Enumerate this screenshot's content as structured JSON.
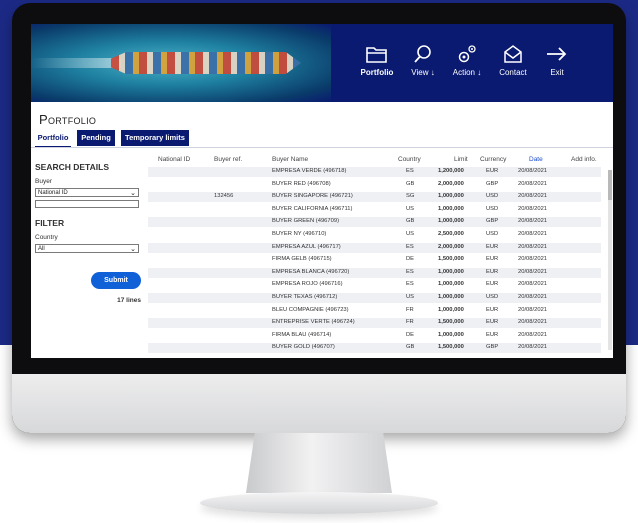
{
  "header": {
    "nav": [
      {
        "label": "Portfolio",
        "icon": "folder-icon",
        "active": true
      },
      {
        "label": "View ↓",
        "icon": "search-icon",
        "active": false
      },
      {
        "label": "Action ↓",
        "icon": "gears-icon",
        "active": false
      },
      {
        "label": "Contact",
        "icon": "envelope-icon",
        "active": false
      },
      {
        "label": "Exit",
        "icon": "arrow-right-icon",
        "active": false
      }
    ]
  },
  "page": {
    "title": "Portfolio",
    "tabs": [
      {
        "label": "Portfolio"
      },
      {
        "label": "Pending"
      },
      {
        "label": "Temporary limits"
      }
    ]
  },
  "sidebar": {
    "search_title": "SEARCH DETAILS",
    "buyer_label": "Buyer",
    "buyer_select_value": "National ID",
    "buyer_input_value": "",
    "filter_title": "FILTER",
    "country_label": "Country",
    "country_select_value": "All",
    "submit_label": "Submit",
    "lines_count": "17 lines"
  },
  "table": {
    "columns": [
      "National ID",
      "Buyer ref.",
      "Buyer Name",
      "Country",
      "Limit",
      "Currency",
      "Date",
      "Add info."
    ],
    "rows": [
      {
        "national_id": "",
        "buyer_ref": "",
        "buyer_name": "EMPRESA VERDE (496718)",
        "country": "ES",
        "limit": "1,200,000",
        "currency": "EUR",
        "date": "20/08/2021",
        "add_info": ""
      },
      {
        "national_id": "",
        "buyer_ref": "",
        "buyer_name": "BUYER RED (496708)",
        "country": "GB",
        "limit": "2,000,000",
        "currency": "GBP",
        "date": "20/08/2021",
        "add_info": ""
      },
      {
        "national_id": "",
        "buyer_ref": "132456",
        "buyer_name": "BUYER SINGAPORE (496721)",
        "country": "SG",
        "limit": "1,000,000",
        "currency": "USD",
        "date": "20/08/2021",
        "add_info": ""
      },
      {
        "national_id": "",
        "buyer_ref": "",
        "buyer_name": "BUYER CALIFORNIA (496711)",
        "country": "US",
        "limit": "1,000,000",
        "currency": "USD",
        "date": "20/08/2021",
        "add_info": ""
      },
      {
        "national_id": "",
        "buyer_ref": "",
        "buyer_name": "BUYER GREEN (496709)",
        "country": "GB",
        "limit": "1,000,000",
        "currency": "GBP",
        "date": "20/08/2021",
        "add_info": ""
      },
      {
        "national_id": "",
        "buyer_ref": "",
        "buyer_name": "BUYER NY (496710)",
        "country": "US",
        "limit": "2,500,000",
        "currency": "USD",
        "date": "20/08/2021",
        "add_info": ""
      },
      {
        "national_id": "",
        "buyer_ref": "",
        "buyer_name": "EMPRESA AZUL (496717)",
        "country": "ES",
        "limit": "2,000,000",
        "currency": "EUR",
        "date": "20/08/2021",
        "add_info": ""
      },
      {
        "national_id": "",
        "buyer_ref": "",
        "buyer_name": "FIRMA GELB (496715)",
        "country": "DE",
        "limit": "1,500,000",
        "currency": "EUR",
        "date": "20/08/2021",
        "add_info": ""
      },
      {
        "national_id": "",
        "buyer_ref": "",
        "buyer_name": "EMPRESA BLANCA (496720)",
        "country": "ES",
        "limit": "1,000,000",
        "currency": "EUR",
        "date": "20/08/2021",
        "add_info": ""
      },
      {
        "national_id": "",
        "buyer_ref": "",
        "buyer_name": "EMPRESA ROJO (496716)",
        "country": "ES",
        "limit": "1,000,000",
        "currency": "EUR",
        "date": "20/08/2021",
        "add_info": ""
      },
      {
        "national_id": "",
        "buyer_ref": "",
        "buyer_name": "BUYER TEXAS (496712)",
        "country": "US",
        "limit": "1,000,000",
        "currency": "USD",
        "date": "20/08/2021",
        "add_info": ""
      },
      {
        "national_id": "",
        "buyer_ref": "",
        "buyer_name": "BLEU COMPAGNIE (496723)",
        "country": "FR",
        "limit": "1,000,000",
        "currency": "EUR",
        "date": "20/08/2021",
        "add_info": ""
      },
      {
        "national_id": "",
        "buyer_ref": "",
        "buyer_name": "ENTREPRISE VERTE (496724)",
        "country": "FR",
        "limit": "1,500,000",
        "currency": "EUR",
        "date": "20/08/2021",
        "add_info": ""
      },
      {
        "national_id": "",
        "buyer_ref": "",
        "buyer_name": "FIRMA BLAU (496714)",
        "country": "DE",
        "limit": "1,000,000",
        "currency": "EUR",
        "date": "20/08/2021",
        "add_info": ""
      },
      {
        "national_id": "",
        "buyer_ref": "",
        "buyer_name": "BUYER GOLD (496707)",
        "country": "GB",
        "limit": "1,500,000",
        "currency": "GBP",
        "date": "20/08/2021",
        "add_info": ""
      }
    ]
  },
  "colors": {
    "brand_navy": "#0a1a70",
    "page_background": "#1c2a86",
    "submit_blue": "#1060d8",
    "date_header": "#1a4cd0"
  }
}
